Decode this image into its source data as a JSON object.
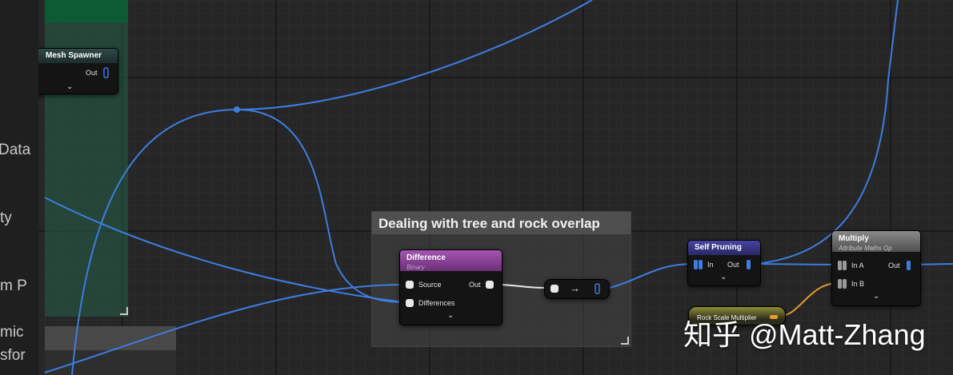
{
  "left_panel": {
    "items": [
      "Data",
      "ty",
      "m P",
      "mic",
      "sfor"
    ]
  },
  "comment": {
    "title": "Dealing with tree and rock overlap"
  },
  "nodes": {
    "mesh_spawner": {
      "title": "Mesh Spawner",
      "out": "Out"
    },
    "difference": {
      "title": "Difference",
      "subtitle": "Binary",
      "pin_source": "Source",
      "pin_differences": "Differences",
      "out": "Out",
      "color": "#9b4aa8"
    },
    "reroute": {
      "arrow": "→"
    },
    "self_pruning": {
      "title": "Self Pruning",
      "pin_in": "In",
      "out": "Out",
      "color": "#3c3a8a"
    },
    "multiply": {
      "title": "Multiply",
      "subtitle": "Attribute Maths Op",
      "pin_a": "In A",
      "pin_b": "In B",
      "out": "Out",
      "color": "#7a7a7a"
    },
    "rock_scale": {
      "title": "Rock Scale Multiplier"
    }
  },
  "watermark": "知乎 @Matt-Zhang",
  "colors": {
    "wire": "#3d7de0",
    "float_wire": "#e39b2d"
  }
}
